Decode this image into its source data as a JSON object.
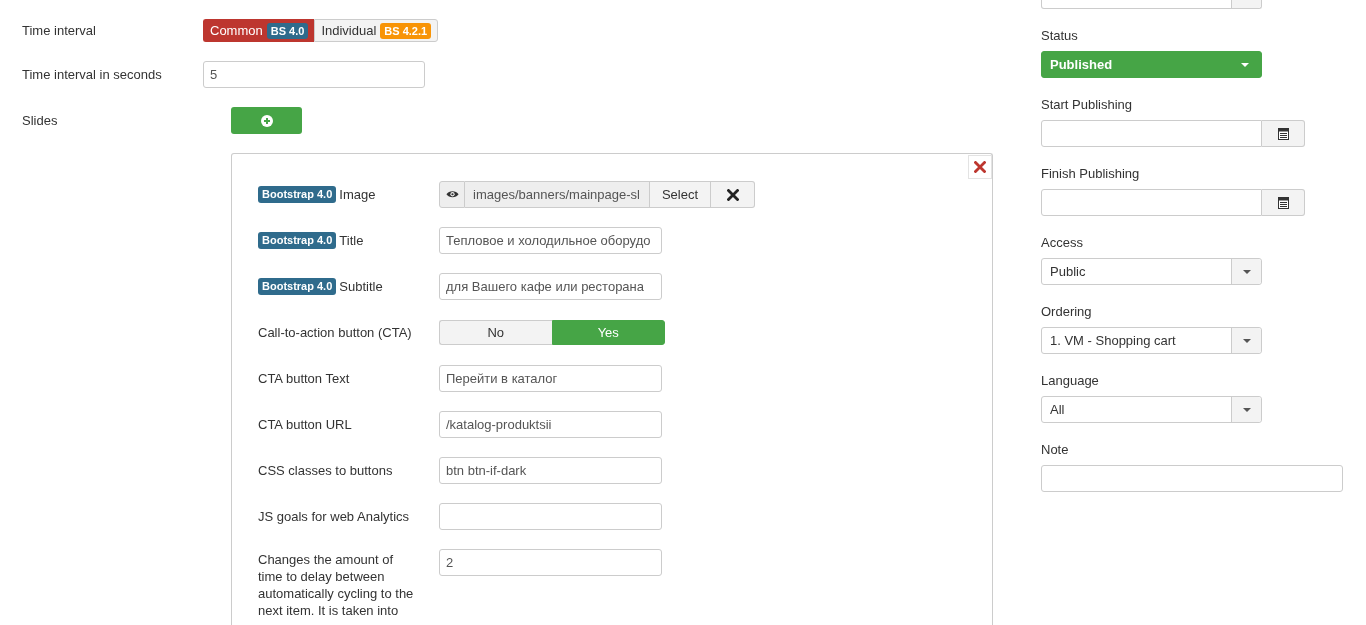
{
  "main_fields": [
    {
      "kind": "toggle",
      "label": "Time interval",
      "options": [
        {
          "label": "Common",
          "badge": {
            "text": "BS 4.0",
            "color": "#2f6b8c"
          },
          "selected": true
        },
        {
          "label": "Individual",
          "badge": {
            "text": "BS 4.2.1",
            "color": "#f89406"
          },
          "selected": false
        }
      ]
    },
    {
      "kind": "text",
      "label": "Time interval in seconds",
      "value": "5"
    },
    {
      "kind": "add",
      "label": "Slides"
    }
  ],
  "slide": {
    "fields": [
      {
        "kind": "media",
        "badge": "Bootstrap 4.0",
        "label": "Image",
        "value": "images/banners/mainpage-sl",
        "button": "Select"
      },
      {
        "kind": "text",
        "badge": "Bootstrap 4.0",
        "label": "Title",
        "value": "Тепловое и холодильное оборудо"
      },
      {
        "kind": "text",
        "badge": "Bootstrap 4.0",
        "label": "Subtitle",
        "value": "для Вашего кафе или ресторана"
      },
      {
        "kind": "toggle",
        "label": "Call-to-action button (CTA)",
        "options": [
          {
            "label": "No",
            "selected": false
          },
          {
            "label": "Yes",
            "selected": true
          }
        ]
      },
      {
        "kind": "text",
        "label": "CTA button Text",
        "value": "Перейти в каталог"
      },
      {
        "kind": "text",
        "label": "CTA button URL",
        "value": "/katalog-produktsii"
      },
      {
        "kind": "text",
        "label": "CSS classes to buttons",
        "value": "btn btn-if-dark"
      },
      {
        "kind": "text",
        "label": "JS goals for web Analytics"
      },
      {
        "kind": "text",
        "label": "Changes the amount of time to delay between automatically cycling to the next item. It is taken into",
        "value": "2"
      }
    ]
  },
  "sidebar": [
    {
      "kind": "cut_select"
    },
    {
      "kind": "status_select",
      "label": "Status",
      "value": "Published"
    },
    {
      "kind": "date",
      "label": "Start Publishing"
    },
    {
      "kind": "date",
      "label": "Finish Publishing"
    },
    {
      "kind": "select",
      "label": "Access",
      "value": "Public"
    },
    {
      "kind": "select",
      "label": "Ordering",
      "value": "1. VM - Shopping cart"
    },
    {
      "kind": "select",
      "label": "Language",
      "value": "All"
    },
    {
      "kind": "text",
      "label": "Note"
    }
  ]
}
